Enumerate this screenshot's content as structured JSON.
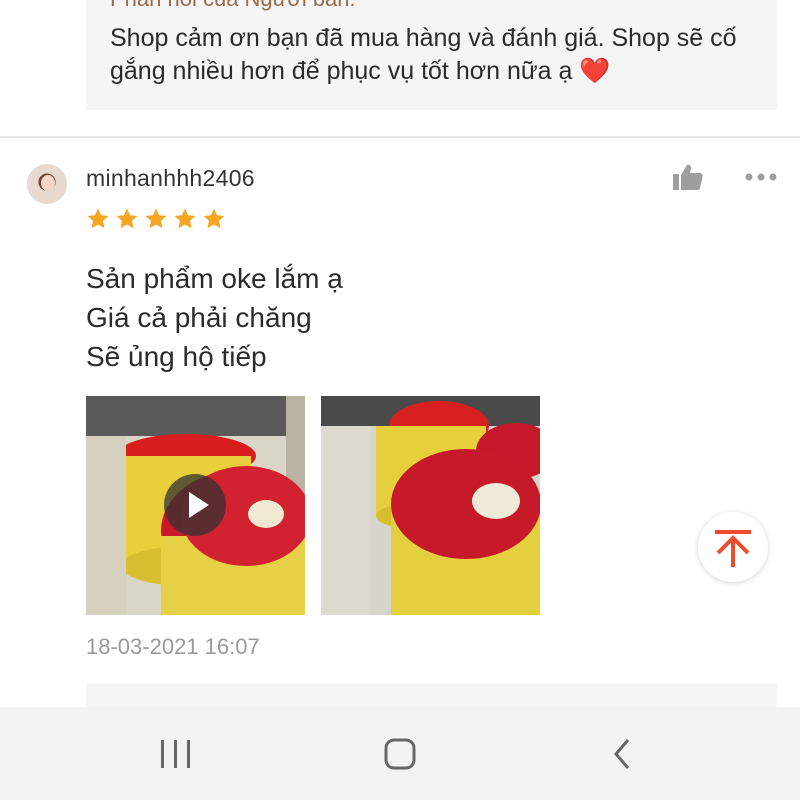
{
  "seller_reply_top": {
    "heading": "Phản hồi của Người bán:",
    "text": "Shop cảm ơn bạn đã mua hàng và đánh giá. Shop sẽ cố gắng nhiều hơn để phục vụ tốt hơn nữa ạ",
    "emoji": "❤️"
  },
  "review": {
    "username": "minhanhhh2406",
    "rating": 5,
    "text_lines": [
      "Sản phẩm oke lắm ạ",
      "Giá cả phải chăng",
      "Sẽ ủng hộ tiếp"
    ],
    "timestamp": "18-03-2021 16:07",
    "media": [
      {
        "kind": "video",
        "icon": "play-icon"
      },
      {
        "kind": "image"
      }
    ]
  },
  "icons": {
    "like": "thumbs-up-icon",
    "more": "more-dots-icon",
    "scroll_top": "arrow-to-top-icon",
    "nav_recents": "recents-icon",
    "nav_home": "home-icon",
    "nav_back": "back-icon"
  },
  "colors": {
    "star": "#f5a623",
    "accent": "#ee4d2d",
    "heart": "#e8202a"
  }
}
